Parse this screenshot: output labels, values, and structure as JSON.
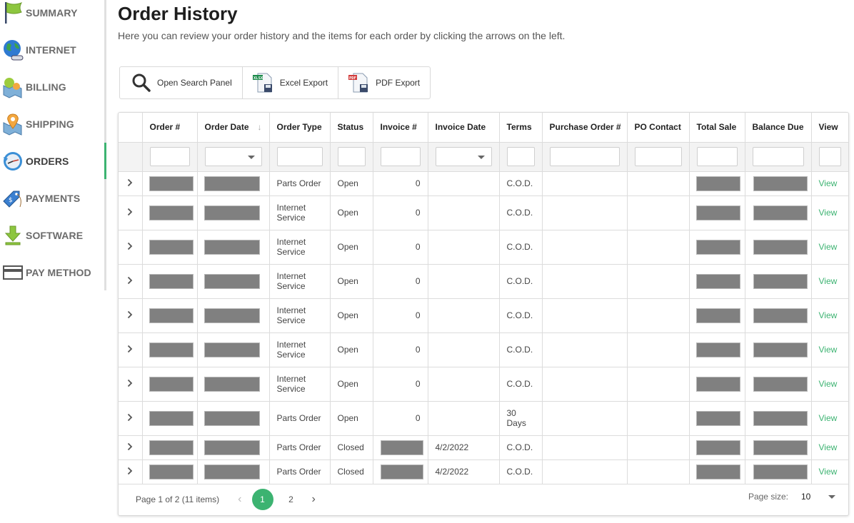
{
  "sidebar": {
    "items": [
      {
        "label": "SUMMARY",
        "icon": "flag-icon"
      },
      {
        "label": "INTERNET",
        "icon": "globe-icon"
      },
      {
        "label": "BILLING",
        "icon": "map-balloons-icon"
      },
      {
        "label": "SHIPPING",
        "icon": "map-pin-icon"
      },
      {
        "label": "ORDERS",
        "icon": "clock-history-icon",
        "active": true
      },
      {
        "label": "PAYMENTS",
        "icon": "price-tag-icon"
      },
      {
        "label": "SOFTWARE",
        "icon": "download-icon"
      },
      {
        "label": "PAY METHOD",
        "icon": "credit-card-icon"
      }
    ],
    "active_color": "#3cb371"
  },
  "header": {
    "title": "Order History",
    "description": "Here you can review your order history and the items for each order by clicking the arrows on the left."
  },
  "toolbar": {
    "search_label": "Open Search Panel",
    "excel_label": "Excel Export",
    "excel_badge": "XLSX",
    "pdf_label": "PDF Export",
    "pdf_badge": "PDF"
  },
  "grid": {
    "columns": [
      "Order #",
      "Order Date",
      "Order Type",
      "Status",
      "Invoice #",
      "Invoice Date",
      "Terms",
      "Purchase Order #",
      "PO Contact",
      "Total Sale",
      "Balance Due",
      "View"
    ],
    "sorted_column": "Order Date",
    "rows": [
      {
        "order_type": "Parts Order",
        "status": "Open",
        "invoice": "0",
        "invoice_date": "",
        "terms": "C.O.D.",
        "view": "View"
      },
      {
        "order_type": "Internet Service",
        "status": "Open",
        "invoice": "0",
        "invoice_date": "",
        "terms": "C.O.D.",
        "view": "View"
      },
      {
        "order_type": "Internet Service",
        "status": "Open",
        "invoice": "0",
        "invoice_date": "",
        "terms": "C.O.D.",
        "view": "View"
      },
      {
        "order_type": "Internet Service",
        "status": "Open",
        "invoice": "0",
        "invoice_date": "",
        "terms": "C.O.D.",
        "view": "View"
      },
      {
        "order_type": "Internet Service",
        "status": "Open",
        "invoice": "0",
        "invoice_date": "",
        "terms": "C.O.D.",
        "view": "View"
      },
      {
        "order_type": "Internet Service",
        "status": "Open",
        "invoice": "0",
        "invoice_date": "",
        "terms": "C.O.D.",
        "view": "View"
      },
      {
        "order_type": "Internet Service",
        "status": "Open",
        "invoice": "0",
        "invoice_date": "",
        "terms": "C.O.D.",
        "view": "View"
      },
      {
        "order_type": "Parts Order",
        "status": "Open",
        "invoice": "0",
        "invoice_date": "",
        "terms": "30 Days",
        "view": "View"
      },
      {
        "order_type": "Parts Order",
        "status": "Closed",
        "invoice": "",
        "invoice_redacted": true,
        "invoice_date": "4/2/2022",
        "terms": "C.O.D.",
        "view": "View"
      },
      {
        "order_type": "Parts Order",
        "status": "Closed",
        "invoice": "",
        "invoice_redacted": true,
        "invoice_date": "4/2/2022",
        "terms": "C.O.D.",
        "view": "View"
      }
    ],
    "redacted_fields": [
      "Order #",
      "Order Date",
      "Total Sale",
      "Balance Due"
    ]
  },
  "pager": {
    "summary": "Page 1 of 2 (11 items)",
    "pages": [
      "1",
      "2"
    ],
    "current_page": "1",
    "page_size_label": "Page size:",
    "page_size": "10"
  }
}
